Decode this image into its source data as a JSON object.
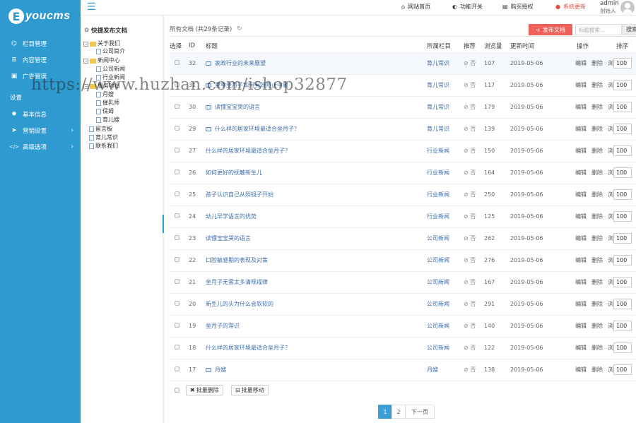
{
  "brand": {
    "badge": "E",
    "name": "youcms"
  },
  "sidebar": {
    "items": [
      {
        "icon": "sitemap-icon",
        "glyph": "⌬",
        "label": "栏目管理"
      },
      {
        "icon": "list-icon",
        "glyph": "≣",
        "label": "内容管理"
      },
      {
        "icon": "image-icon",
        "glyph": "▣",
        "label": "广告管理"
      }
    ],
    "section": "设置",
    "settings": [
      {
        "icon": "gear-icon",
        "glyph": "✹",
        "label": "基本信息"
      },
      {
        "icon": "send-icon",
        "glyph": "➤",
        "label": "营销设置"
      },
      {
        "icon": "code-icon",
        "glyph": "</>",
        "label": "高级选项"
      }
    ]
  },
  "topbar": {
    "home": "网站首页",
    "features": "功能开关",
    "buy": "购买授权",
    "update": "系统更新",
    "user_name": "admin",
    "user_role": "创始人"
  },
  "tree": {
    "title": "快捷发布文档",
    "nodes": [
      "关于我们",
      "公司简介",
      "新闻中心",
      "公司新闻",
      "行业新闻",
      "服务项目",
      "月嫂",
      "催乳师",
      "保姆",
      "育儿嫂",
      "留言板",
      "育儿常识",
      "联系我们"
    ]
  },
  "main": {
    "heading": "所有文档 (共29条记录)",
    "publish": "发布文档",
    "search_placeholder": "标题搜索...",
    "search_button": "搜索",
    "columns": {
      "select": "选择",
      "id": "ID",
      "title": "标题",
      "category": "所属栏目",
      "recommend": "推荐",
      "views": "浏览量",
      "updated": "更新时间",
      "ops": "操作",
      "order": "排序"
    },
    "op_labels": {
      "edit": "编辑",
      "delete": "删除",
      "view": "浏览"
    },
    "rows": [
      {
        "id": "32",
        "title": "家政行业的未来展望",
        "category": "育儿常识",
        "flag": "否",
        "views": "107",
        "date": "2019-05-06",
        "order": "100",
        "img": true
      },
      {
        "id": "31",
        "title": "夏季坐月子如何有效防止中暑",
        "category": "育儿常识",
        "flag": "否",
        "views": "117",
        "date": "2019-05-06",
        "order": "100",
        "img": true
      },
      {
        "id": "30",
        "title": "读懂宝宝哭的语言",
        "category": "育儿常识",
        "flag": "否",
        "views": "179",
        "date": "2019-05-06",
        "order": "100",
        "img": true
      },
      {
        "id": "29",
        "title": "什么样的居家环境最适合坐月子？",
        "category": "育儿常识",
        "flag": "否",
        "views": "139",
        "date": "2019-05-06",
        "order": "100",
        "img": true
      },
      {
        "id": "27",
        "title": "什么样的居家环境最适合坐月子？",
        "category": "行业新闻",
        "flag": "否",
        "views": "150",
        "date": "2019-05-06",
        "order": "100",
        "img": false
      },
      {
        "id": "26",
        "title": "如何更好的抚触新生儿",
        "category": "行业新闻",
        "flag": "否",
        "views": "164",
        "date": "2019-05-06",
        "order": "100",
        "img": false
      },
      {
        "id": "25",
        "title": "孩子认识自己从照镜子开始",
        "category": "行业新闻",
        "flag": "否",
        "views": "250",
        "date": "2019-05-06",
        "order": "100",
        "img": false
      },
      {
        "id": "24",
        "title": "幼儿早学语言的优势",
        "category": "行业新闻",
        "flag": "否",
        "views": "125",
        "date": "2019-05-06",
        "order": "100",
        "img": false
      },
      {
        "id": "23",
        "title": "读懂宝宝哭的语言",
        "category": "公司新闻",
        "flag": "否",
        "views": "262",
        "date": "2019-05-06",
        "order": "100",
        "img": false
      },
      {
        "id": "22",
        "title": "口腔敏感期的表现及对策",
        "category": "公司新闻",
        "flag": "否",
        "views": "276",
        "date": "2019-05-06",
        "order": "100",
        "img": false
      },
      {
        "id": "21",
        "title": "坐月子无需太多清规戒律",
        "category": "公司新闻",
        "flag": "否",
        "views": "167",
        "date": "2019-05-06",
        "order": "100",
        "img": false
      },
      {
        "id": "20",
        "title": "新生儿的头为什么会软软的",
        "category": "公司新闻",
        "flag": "否",
        "views": "291",
        "date": "2019-05-06",
        "order": "100",
        "img": false
      },
      {
        "id": "19",
        "title": "坐月子的常识",
        "category": "公司新闻",
        "flag": "否",
        "views": "140",
        "date": "2019-05-06",
        "order": "100",
        "img": false
      },
      {
        "id": "18",
        "title": "什么样的居家环境最适合坐月子？",
        "category": "公司新闻",
        "flag": "否",
        "views": "122",
        "date": "2019-05-06",
        "order": "100",
        "img": false
      },
      {
        "id": "17",
        "title": "月嫂",
        "category": "月嫂",
        "flag": "否",
        "views": "138",
        "date": "2019-05-06",
        "order": "100",
        "img": true
      }
    ],
    "batch_delete": "批量删除",
    "batch_move": "批量移动"
  },
  "pagination": {
    "pages": [
      "1",
      "2"
    ],
    "next": "下一页",
    "current": "1"
  },
  "watermark": "https://www.huzhan.com/ishop32877",
  "colors": {
    "sidebar": "#2e9ad0",
    "accent": "#f0605a",
    "link": "#3f6fa8",
    "alert": "#e54c3c"
  }
}
